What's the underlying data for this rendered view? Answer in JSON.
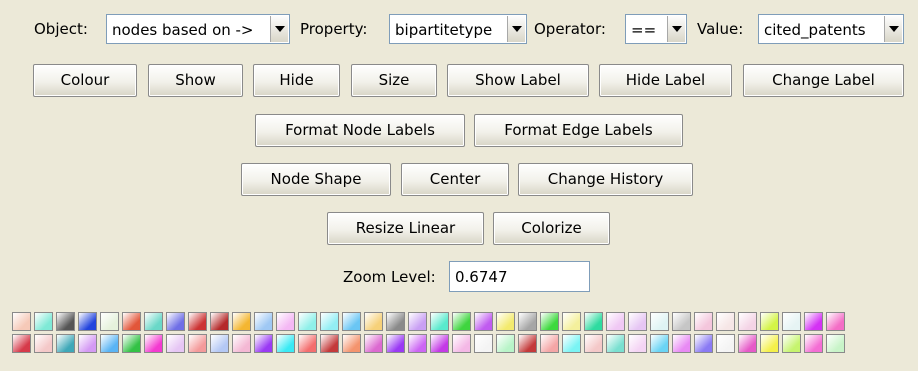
{
  "filter": {
    "object_label": "Object:",
    "object_value": "nodes based on ->",
    "property_label": "Property:",
    "property_value": "bipartitetype",
    "operator_label": "Operator:",
    "operator_value": "==",
    "value_label": "Value:",
    "value_value": "cited_patents"
  },
  "buttons": {
    "colour": "Colour",
    "show": "Show",
    "hide": "Hide",
    "size": "Size",
    "show_label": "Show Label",
    "hide_label": "Hide Label",
    "change_label": "Change Label",
    "format_node_labels": "Format Node Labels",
    "format_edge_labels": "Format Edge Labels",
    "node_shape": "Node Shape",
    "center": "Center",
    "change_history": "Change History",
    "resize_linear": "Resize Linear",
    "colorize": "Colorize"
  },
  "zoom": {
    "label": "Zoom Level:",
    "value": "0.6747"
  },
  "palette": {
    "row1": [
      "#f6c9b8",
      "#7fe9d6",
      "#555555",
      "#2244dd",
      "#e6f2dc",
      "#e2563a",
      "#6ad8c8",
      "#6f6fe6",
      "#cc3333",
      "#b52a2a",
      "#f4b631",
      "#9fc8f4",
      "#f4b8f4",
      "#8ff0e9",
      "#93eef4",
      "#6ac6f4",
      "#f6d179",
      "#8a8a8a",
      "#c9a0f4",
      "#59eacd",
      "#3fd53f",
      "#c05bf0",
      "#f3ea6e",
      "#a6a6a6",
      "#3ed93e",
      "#f4f09c",
      "#2fdba0",
      "#f0c8f4",
      "#e6c6f4",
      "#dff4f4",
      "#c6c6c6",
      "#f4c6dc",
      "#f6e6e6",
      "#f4d4e6",
      "#d4f446",
      "#e6f4f4",
      "#d432f4",
      "#f46ec6"
    ],
    "row2": [
      "#d63a4a",
      "#f4c8c8",
      "#3fa8b8",
      "#d49af4",
      "#5ab4f4",
      "#33c245",
      "#f43ad0",
      "#e6c6f4",
      "#f49a9a",
      "#b4c8f4",
      "#f4b8d4",
      "#9a3af4",
      "#3aeaf4",
      "#f46e6e",
      "#c43a3a",
      "#f4946e",
      "#dc6ad0",
      "#9a3af4",
      "#cc66f4",
      "#c43ae6",
      "#f4b8e6",
      "#f4f4f4",
      "#b8f4c8",
      "#c43a3a",
      "#f4a6a6",
      "#7af4f4",
      "#f4c8c8",
      "#7ae0d0",
      "#f4d4f4",
      "#6ad4f4",
      "#e88af4",
      "#8a7af4",
      "#f4f4f4",
      "#e65ac8",
      "#f4f04a",
      "#c6f46e",
      "#f46ed4",
      "#c8f4c8"
    ]
  }
}
